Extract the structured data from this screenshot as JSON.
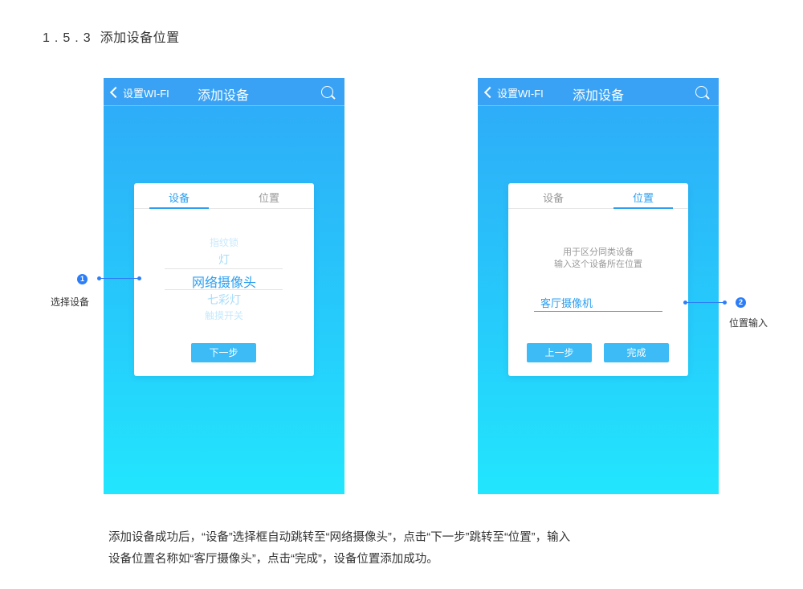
{
  "section": {
    "number": "1.5.3",
    "title": "添加设备位置"
  },
  "screens": [
    {
      "navbar": {
        "back_label": "设置WI-FI",
        "title": "添加设备",
        "icon": "search-icon"
      },
      "tabs": [
        "设备",
        "位置"
      ],
      "active_tab": "设备",
      "picker": [
        "",
        "指纹锁",
        "灯",
        "网络摄像头",
        "七彩灯",
        "触摸开关"
      ],
      "selected_item": "网络摄像头",
      "button": "下一步"
    },
    {
      "navbar": {
        "back_label": "设置WI-FI",
        "title": "添加设备",
        "icon": "search-icon"
      },
      "tabs": [
        "设备",
        "位置"
      ],
      "active_tab": "位置",
      "hint_line1": "用于区分同类设备",
      "hint_line2": "输入这个设备所在位置",
      "location_value": "客厅摄像机",
      "button_prev": "上一步",
      "button_done": "完成"
    }
  ],
  "callouts": [
    {
      "number": "1",
      "label": "选择设备"
    },
    {
      "number": "2",
      "label": "位置输入"
    }
  ],
  "description": {
    "line1": "添加设备成功后，“设备”选择框自动跳转至“网络摄像头”，点击“下一步”跳转至“位置”，输入",
    "line2": "设备位置名称如“客厅摄像头”，点击“完成”，设备位置添加成功。"
  },
  "colors": {
    "accent": "#2c9ff0",
    "nav": "#3aa2f4",
    "button": "#3dbbf6",
    "callout": "#2c7ef8"
  }
}
